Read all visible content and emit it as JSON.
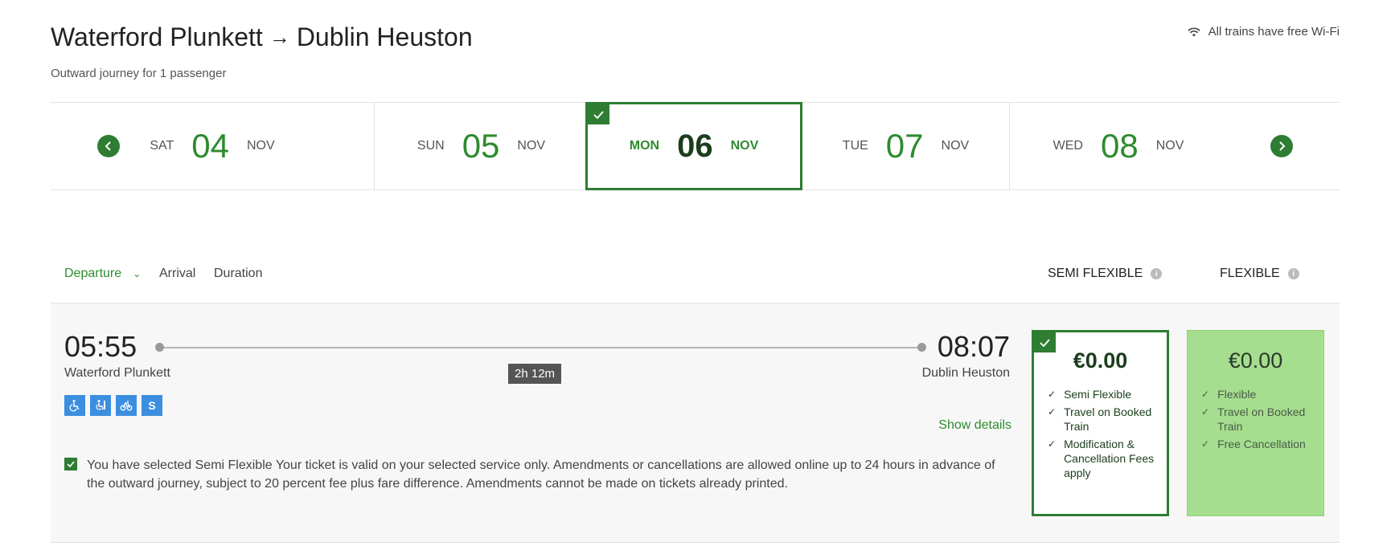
{
  "header": {
    "origin": "Waterford Plunkett",
    "arrow": "→",
    "destination": "Dublin Heuston",
    "subtitle": "Outward journey for 1 passenger",
    "wifi_text": "All trains have free Wi-Fi",
    "wifi_icon": "wifi-icon"
  },
  "dates": [
    {
      "dow": "SAT",
      "day": "04",
      "month": "NOV",
      "selected": false
    },
    {
      "dow": "SUN",
      "day": "05",
      "month": "NOV",
      "selected": false
    },
    {
      "dow": "MON",
      "day": "06",
      "month": "NOV",
      "selected": true
    },
    {
      "dow": "TUE",
      "day": "07",
      "month": "NOV",
      "selected": false
    },
    {
      "dow": "WED",
      "day": "08",
      "month": "NOV",
      "selected": false
    }
  ],
  "sort": {
    "departure": "Departure",
    "arrival": "Arrival",
    "duration": "Duration"
  },
  "fare_types": {
    "semi": "SEMI FLEXIBLE",
    "flex": "FLEXIBLE"
  },
  "journey": {
    "dep_time": "05:55",
    "dep_station": "Waterford Plunkett",
    "arr_time": "08:07",
    "arr_station": "Dublin Heuston",
    "duration": "2h 12m",
    "amenities": [
      "wheelchair-icon",
      "accessible-toilet-icon",
      "bicycle-icon",
      "S"
    ],
    "show_details": "Show details",
    "notice": "You have selected Semi Flexible Your ticket is valid on your selected service only. Amendments or cancellations are allowed online up to 24 hours in advance of the outward journey, subject to 20 percent fee plus fare difference. Amendments cannot be made on tickets already printed."
  },
  "fares": {
    "semi": {
      "price": "€0.00",
      "features": [
        "Semi Flexible",
        "Travel on Booked Train",
        "Modification & Cancellation Fees apply"
      ],
      "selected": true
    },
    "flex": {
      "price": "€0.00",
      "features": [
        "Flexible",
        "Travel on Booked Train",
        "Free Cancellation"
      ],
      "selected": false
    }
  },
  "colors": {
    "accent_green": "#2e7d32",
    "light_green": "#a5de8e",
    "amenity_blue": "#3c8ee0"
  }
}
